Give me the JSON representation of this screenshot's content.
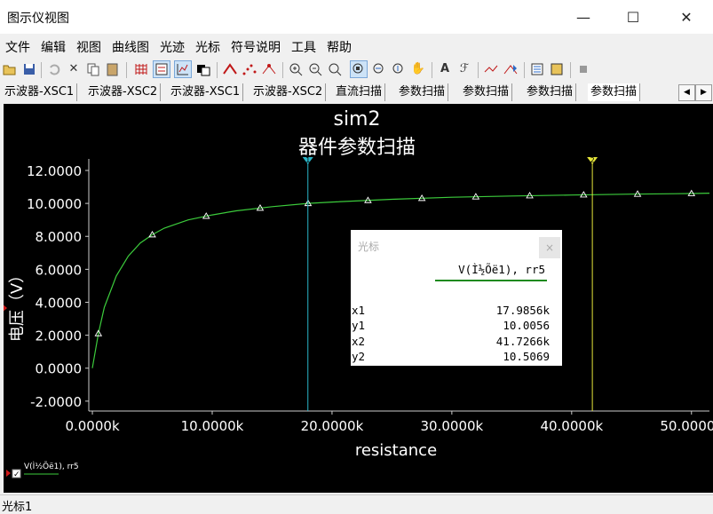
{
  "window": {
    "title": "图示仪视图",
    "minimize": "—",
    "maximize": "☐",
    "close": "✕"
  },
  "menu": [
    "文件",
    "编辑",
    "视图",
    "曲线图",
    "光迹",
    "光标",
    "符号说明",
    "工具",
    "帮助"
  ],
  "toolbar_icons": [
    "open-icon",
    "save-icon",
    "undo-icon",
    "cut-icon",
    "copy-icon",
    "paste-icon",
    "grid-icon",
    "legend-icon",
    "graph-icon",
    "overlay-icon",
    "trace-icon",
    "dots-icon",
    "markers-icon",
    "zoom-in-icon",
    "zoom-out-icon",
    "zoom-fit-icon",
    "zoom-area-icon",
    "zoom-x-icon",
    "zoom-y-icon",
    "pan-icon",
    "text-icon",
    "font-icon",
    "cursor-icon",
    "go-marker-icon",
    "export-icon",
    "transfer-icon",
    "stop-icon"
  ],
  "tabs": [
    "示波器-XSC1",
    "示波器-XSC2",
    "示波器-XSC1",
    "示波器-XSC2",
    "直流扫描",
    "参数扫描",
    "参数扫描",
    "参数扫描",
    "参数扫描"
  ],
  "active_tab": 8,
  "tab_arrows": {
    "left": "◀",
    "right": "▶"
  },
  "chart_data": {
    "type": "line",
    "title": "sim2",
    "subtitle": "器件参数扫描",
    "xlabel": "resistance",
    "ylabel": "电压（V）",
    "xlim": [
      -0.3,
      51.5
    ],
    "ylim": [
      -2.6,
      12.7
    ],
    "x_ticks": [
      0,
      10,
      20,
      30,
      40,
      50
    ],
    "x_tick_labels": [
      "0.0000k",
      "10.0000k",
      "20.0000k",
      "30.0000k",
      "40.0000k",
      "50.0000k"
    ],
    "y_ticks": [
      -2,
      0,
      2,
      4,
      6,
      8,
      10,
      12
    ],
    "y_tick_labels": [
      "-2.0000",
      "0.0000",
      "2.0000",
      "4.0000",
      "6.0000",
      "8.0000",
      "10.0000",
      "12.0000"
    ],
    "series": [
      {
        "name": "V(Ì½Õë1), rr5",
        "color": "#3ccc3c",
        "x": [
          0,
          0.5,
          1,
          2,
          3,
          4,
          5,
          6,
          8,
          10,
          12,
          15,
          18,
          20,
          25,
          30,
          35,
          40,
          45,
          50,
          51.5
        ],
        "y": [
          0,
          2.1,
          3.7,
          5.6,
          6.8,
          7.6,
          8.1,
          8.5,
          9.0,
          9.3,
          9.55,
          9.8,
          10.0,
          10.08,
          10.25,
          10.37,
          10.45,
          10.51,
          10.56,
          10.6,
          10.62
        ]
      }
    ],
    "markers_x": [
      0.5,
      5,
      9.5,
      14,
      18,
      23,
      27.5,
      32,
      36.5,
      41,
      45.5,
      50
    ],
    "grid": false,
    "legend": "bottom-left"
  },
  "cursors": {
    "x1": 17.9856,
    "x2": 41.7266,
    "cursor1_color": "#2ab6c8",
    "cursor2_color": "#e6e63a",
    "cursor1_label": "1",
    "cursor2_label": "2"
  },
  "cursor_panel": {
    "title": "光标",
    "close": "×",
    "column": "V(Ì½Õë1), rr5",
    "rows": [
      {
        "key": "x1",
        "value": "17.9856k"
      },
      {
        "key": "y1",
        "value": "10.0056"
      },
      {
        "key": "x2",
        "value": "41.7266k"
      },
      {
        "key": "y2",
        "value": "10.5069"
      }
    ]
  },
  "legend": {
    "label": "V(Ì½Õë1), rr5",
    "checked": "✓"
  },
  "status": "光标1"
}
